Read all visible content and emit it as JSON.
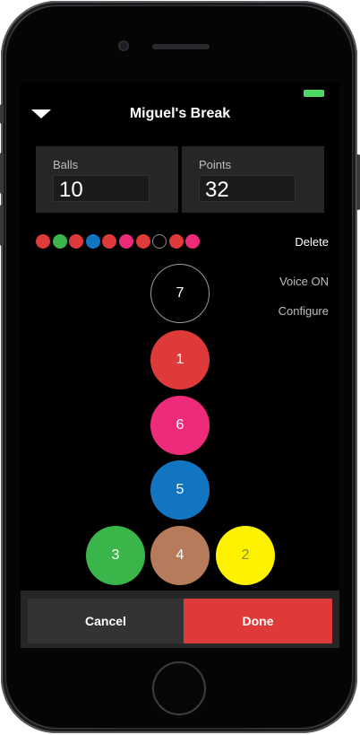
{
  "header": {
    "title": "Miguel's Break"
  },
  "colors": {
    "accent": "#de3a3a",
    "battery": "#4cd964",
    "panel": "#262628"
  },
  "stats": {
    "balls": {
      "label": "Balls",
      "value": "10"
    },
    "points": {
      "label": "Points",
      "value": "32"
    }
  },
  "history": [
    {
      "color": "#de3a3a"
    },
    {
      "color": "#3ab54a"
    },
    {
      "color": "#de3a3a"
    },
    {
      "color": "#1275c2"
    },
    {
      "color": "#de3a3a"
    },
    {
      "color": "#ee2a7b"
    },
    {
      "color": "#de3a3a"
    },
    {
      "color": "#000000",
      "border": "#8a8a8a"
    },
    {
      "color": "#de3a3a"
    },
    {
      "color": "#ee2a7b"
    }
  ],
  "side_actions": {
    "delete": "Delete",
    "voice": "Voice ON",
    "configure": "Configure"
  },
  "balls": [
    {
      "number": "7",
      "color": "#000000",
      "border": "#9a9a9a",
      "text_color": "#ffffff"
    },
    {
      "number": "1",
      "color": "#de3a3a",
      "text_color": "#ffffff"
    },
    {
      "number": "6",
      "color": "#ee2a7b",
      "text_color": "#ffffff"
    },
    {
      "number": "5",
      "color": "#1275c2",
      "text_color": "#ffffff"
    },
    {
      "number": "3",
      "color": "#3ab54a",
      "text_color": "#ffffff"
    },
    {
      "number": "4",
      "color": "#b57b5a",
      "text_color": "#ffffff"
    },
    {
      "number": "2",
      "color": "#fff200",
      "text_color": "#8a8a2a"
    }
  ],
  "footer": {
    "cancel_label": "Cancel",
    "done_label": "Done"
  }
}
